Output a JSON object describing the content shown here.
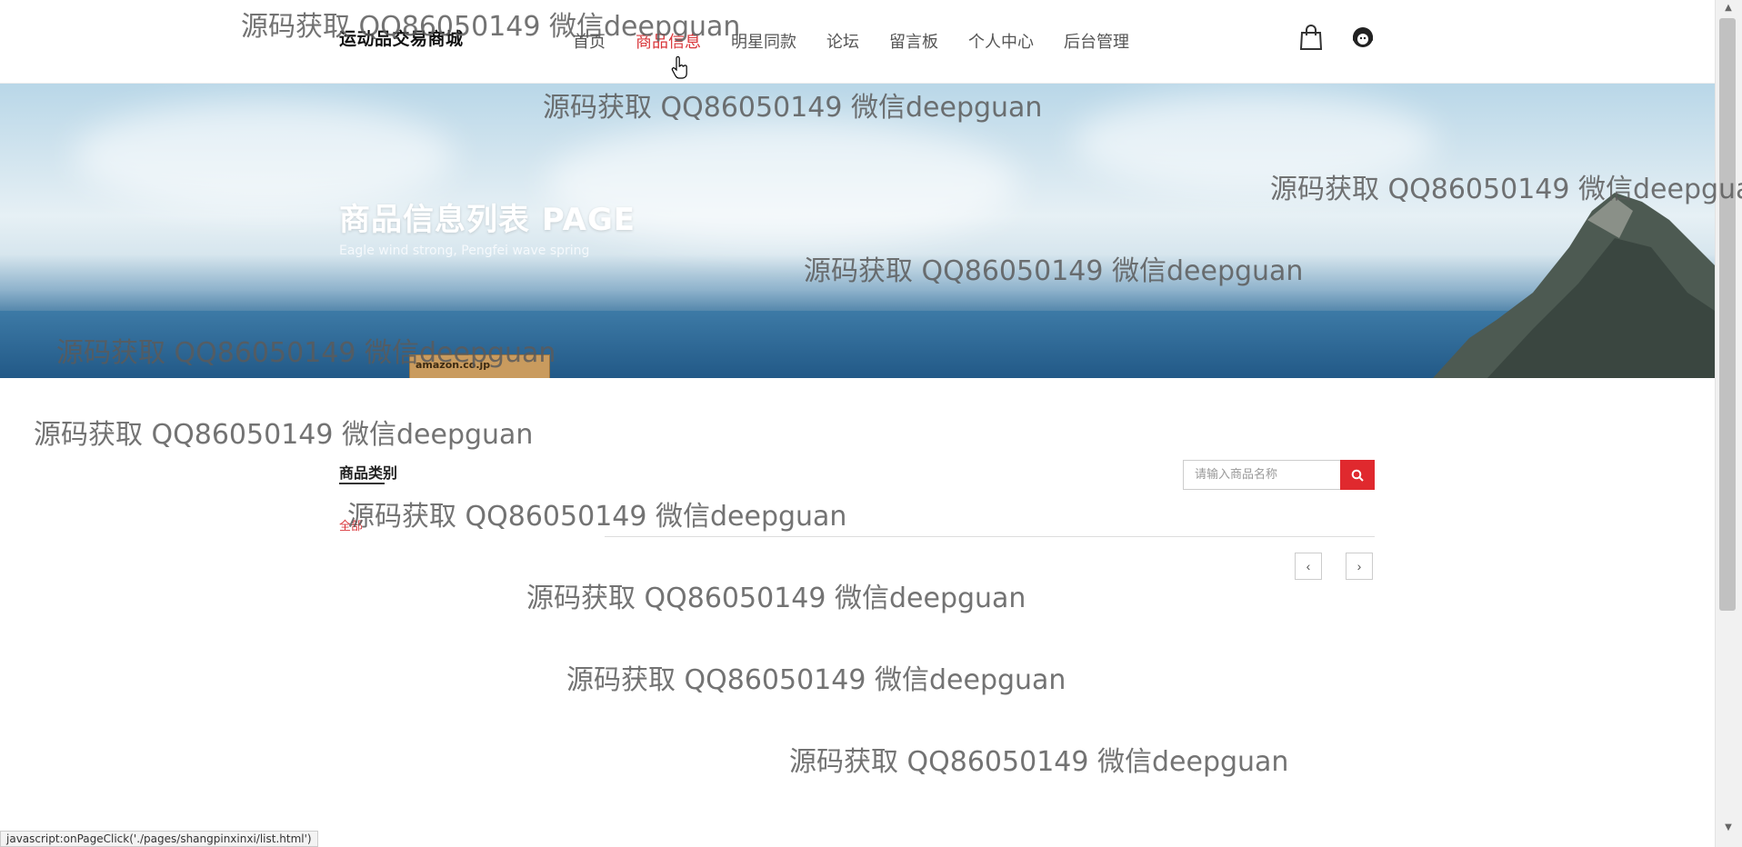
{
  "header": {
    "brand": "运动品交易商城",
    "nav": [
      {
        "label": "首页",
        "active": false
      },
      {
        "label": "商品信息",
        "active": true
      },
      {
        "label": "明星同款",
        "active": false
      },
      {
        "label": "论坛",
        "active": false
      },
      {
        "label": "留言板",
        "active": false
      },
      {
        "label": "个人中心",
        "active": false
      },
      {
        "label": "后台管理",
        "active": false
      }
    ],
    "icons": [
      "shopping-bag-icon",
      "user-avatar-icon"
    ]
  },
  "banner": {
    "title": "商品信息列表 PAGE",
    "subtitle": "Eagle wind strong, Pengfei wave spring",
    "box_label": "amazon.co.jp"
  },
  "filter": {
    "category_title": "商品类别",
    "category_all": "全部",
    "search_placeholder": "请输入商品名称",
    "prev_label": "‹",
    "next_label": "›"
  },
  "watermark": "源码获取 QQ86050149 微信deepguan",
  "watermark_cut": "源码获取 QQ86050149 微信deepgua",
  "status_bar": "javascript:onPageClick('./pages/shangpinxinxi/list.html')",
  "colors": {
    "accent": "#d9363a",
    "search_button": "#e0292e"
  }
}
